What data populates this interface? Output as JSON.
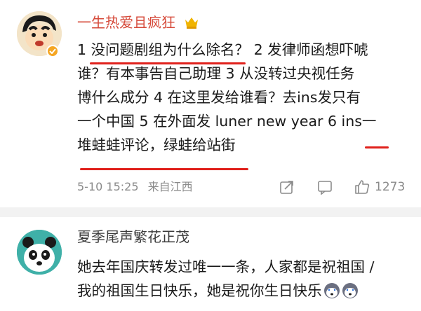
{
  "comments": [
    {
      "username": "一生热爱且疯狂",
      "text_lines": [
        "1 没问题剧组为什么除名？ 2 发律师函想吓唬",
        "谁？有本事告自己助理 3 从没转过央视任务",
        "博什么成分 4 在这里发给谁看？去ins发只有",
        "一个中国 5 在外面发 luner new year  6 ins一",
        "堆蛙蛙评论，绿蛙给站街"
      ],
      "date": "5-10 15:25",
      "location": "来自江西",
      "like_count": "1273",
      "icons": {
        "crown": "crown-icon",
        "verified": "verified-icon",
        "share": "share-icon",
        "reply": "reply-icon",
        "like": "like-icon"
      },
      "colors": {
        "username": "#d64a3a",
        "underline": "#e0211c"
      }
    },
    {
      "username": "夏季尾声繁花正茂",
      "text_lines": [
        "她去年国庆转发过唯一一条，人家都是祝祖国 /",
        "我的祖国生日快乐，她是祝你生日快乐"
      ],
      "icons": {
        "emoji": "husky-emoji"
      }
    }
  ]
}
